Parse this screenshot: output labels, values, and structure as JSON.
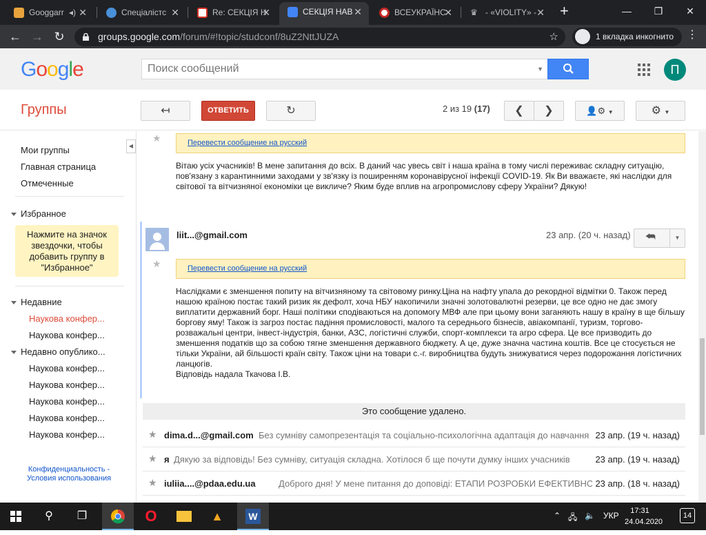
{
  "browser": {
    "tabs": [
      {
        "label": "Googgarr",
        "active": false
      },
      {
        "label": "Спеціалістс",
        "active": false
      },
      {
        "label": "Re: СЕКЦІЯ Н",
        "active": false
      },
      {
        "label": "СЕКЦІЯ НАВ",
        "active": true
      },
      {
        "label": "ВСЕУКРАЇНС",
        "active": false
      },
      {
        "label": "- «VIOLITY» -",
        "active": false
      }
    ],
    "url_host": "groups.google.com",
    "url_path": "/forum/#!topic/studconf/8uZ2NttJUZA",
    "incognito_label": "1 вкладка инкогнито"
  },
  "header": {
    "logo": "Google",
    "search_placeholder": "Поиск сообщений",
    "avatar_letter": "П"
  },
  "toolbar": {
    "title": "Группы",
    "reply_label": "ОТВЕТИТЬ",
    "pager_text": "2 из 19",
    "pager_total": "(17)"
  },
  "sidebar": {
    "links": [
      "Мои группы",
      "Главная страница",
      "Отмеченные"
    ],
    "favorites_label": "Избранное",
    "favorites_note": "Нажмите на значок звездочки, чтобы добавить группу в \"Избранное\"",
    "recent_label": "Недавние",
    "recent_items": [
      "Наукова конфер...",
      "Наукова конфер..."
    ],
    "published_label": "Недавно опублико...",
    "published_items": [
      "Наукова конфер...",
      "Наукова конфер...",
      "Наукова конфер...",
      "Наукова конфер...",
      "Наукова конфер..."
    ],
    "footer": "Конфиденциальность - Условия использования"
  },
  "thread": {
    "translate_label": "Перевести сообщение на русский",
    "msg1_text": "Вітаю усіх учасників! В мене запитання до всіх. В даний час увесь світ і наша країна в тому числі переживає складну ситуацію, пов'язану з карантинними заходами у зв'язку із поширенням коронавірусної інфекції COVID-19. Як Ви вважаєте, які наслідки для світової та вітчизняної економіки це викличе? Яким буде вплив на агропромислову сферу України? Дякую!",
    "msg2_author": "liit...@gmail.com",
    "msg2_date": "23 апр. (20 ч. назад)",
    "msg2_text": "Наслідками є зменшення попиту на вітчизняному та світовому ринку.Ціна на нафту упала до рекордної відмітки 0. Також перед нашою країною постає такий ризик як дефолт, хоча НБУ накопичили значні золотовалютні резерви, це все одно не дає змогу виплатити державний борг. Наші політики сподіваються на допомогу МВФ але при цьому вони заганяють нашу в країну в ще більшу боргову яму! Також із загроз постає падіння промисловості, малого та середнього бізнесів, авіакомпанії, туризм, торгово-розважальні центри, інвест-індустрія, банки, АЗС, логістичні служби, спорт-комплекси та агро сфера. Це все призводить до зменшення податків що за собою тягне зменшення державного бюджету. А це, дуже значна частина коштів. Все це стосується не тільки України, ай більшості країн світу. Також ціни на товари с.-г. виробництва будуть знижуватися через подорожання логістичних ланцюгів.",
    "msg2_signature": "Відповідь надала Ткачова І.В.",
    "deleted_text": "Это сообщение удалено.",
    "rows": [
      {
        "author": "dima.d...@gmail.com",
        "snippet": "Без сумніву самопрезентація та соціально-психологічна адаптація до навчання",
        "date": "23 апр. (19 ч. назад)"
      },
      {
        "author": "я",
        "snippet": "Дякую за відповідь! Без сумніву, ситуація складна. Хотілося б ще почути думку інших учасників",
        "date": "23 апр. (19 ч. назад)"
      },
      {
        "author": "iuliia....@pdaa.edu.ua",
        "snippet": "Доброго дня! У мене питання до доповіді: ЕТАПИ РОЗРОБКИ ЕФЕКТИВНОГО",
        "date": "23 апр. (18 ч. назад)"
      }
    ]
  },
  "taskbar": {
    "lang": "УКР",
    "time": "17:31",
    "date": "24.04.2020",
    "notifications": "14"
  }
}
